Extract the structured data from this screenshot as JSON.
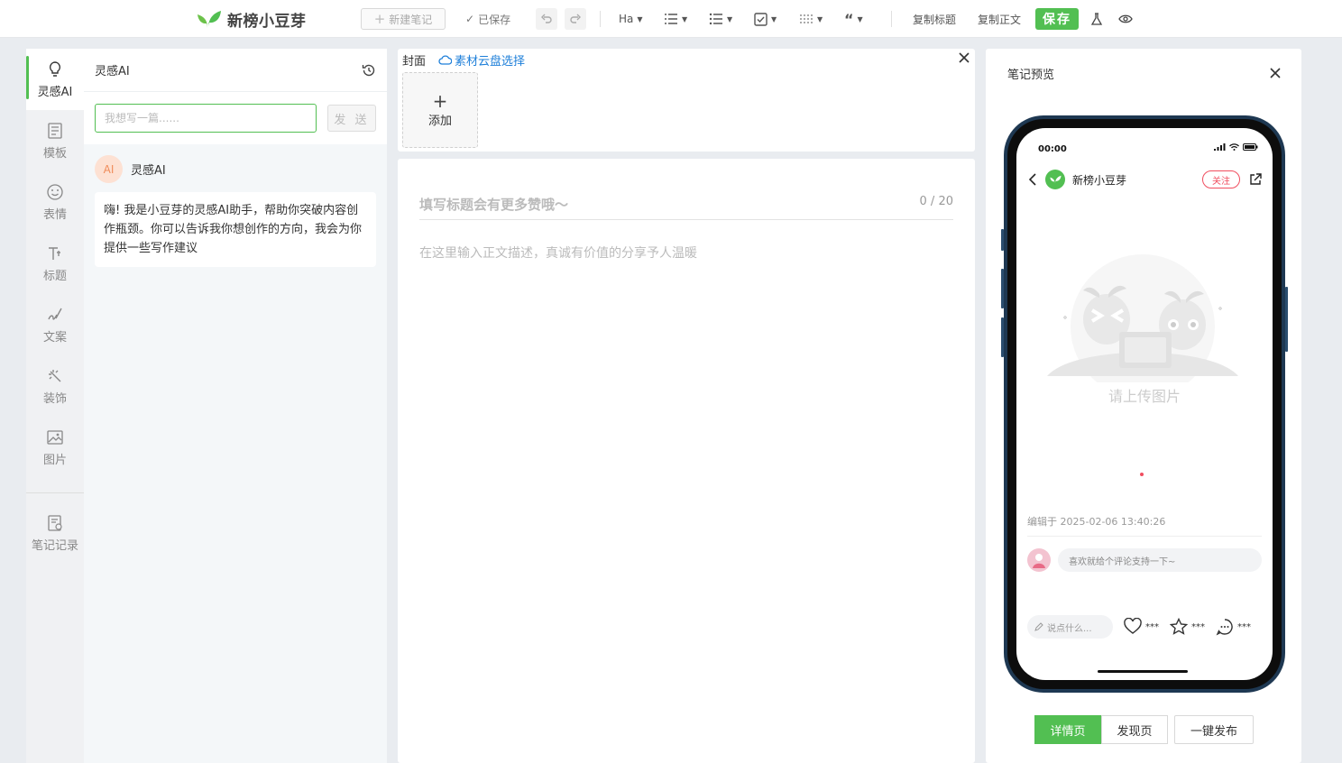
{
  "app": {
    "logo_text": "新榜小豆芽",
    "brand_color": "#52bf52"
  },
  "toolbar": {
    "new_note": "新建笔记",
    "saved": "已保存",
    "heading_fmt": "Ha",
    "copy_title": "复制标题",
    "copy_body": "复制正文",
    "save": "保存"
  },
  "rail": {
    "items": [
      {
        "label": "灵感AI",
        "icon": "bulb-icon",
        "active": true
      },
      {
        "label": "模板",
        "icon": "template-icon"
      },
      {
        "label": "表情",
        "icon": "emoji-icon"
      },
      {
        "label": "标题",
        "icon": "title-icon"
      },
      {
        "label": "文案",
        "icon": "copywriting-icon"
      },
      {
        "label": "装饰",
        "icon": "decoration-icon"
      },
      {
        "label": "图片",
        "icon": "image-icon"
      }
    ],
    "history": {
      "label": "笔记记录",
      "icon": "note-record-icon"
    }
  },
  "ai": {
    "title": "灵感AI",
    "input_placeholder": "我想写一篇......",
    "send": "发 送",
    "avatar": "AI",
    "name": "灵感AI",
    "message": "嗨! 我是小豆芽的灵感AI助手，帮助你突破内容创作瓶颈。你可以告诉我你想创作的方向，我会为你提供一些写作建议"
  },
  "cover": {
    "label": "封面",
    "cloud_link": "素材云盘选择",
    "add": "添加"
  },
  "editor": {
    "title_placeholder": "填写标题会有更多赞哦～",
    "title_count": "0 / 20",
    "body_placeholder": "在这里输入正文描述，真诚有价值的分享予人温暖"
  },
  "preview": {
    "title": "笔记预览",
    "time": "00:00",
    "account_name": "新榜小豆芽",
    "follow": "关注",
    "upload_text": "请上传图片",
    "edited": "编辑于 2025-02-06 13:40:26",
    "comment_placeholder": "喜欢就给个评论支持一下~",
    "say_placeholder": "说点什么...",
    "like_count": "***",
    "collect_count": "***",
    "comment_count": "***",
    "tabs": [
      {
        "label": "详情页",
        "active": true
      },
      {
        "label": "发现页"
      }
    ],
    "publish": "一键发布"
  }
}
